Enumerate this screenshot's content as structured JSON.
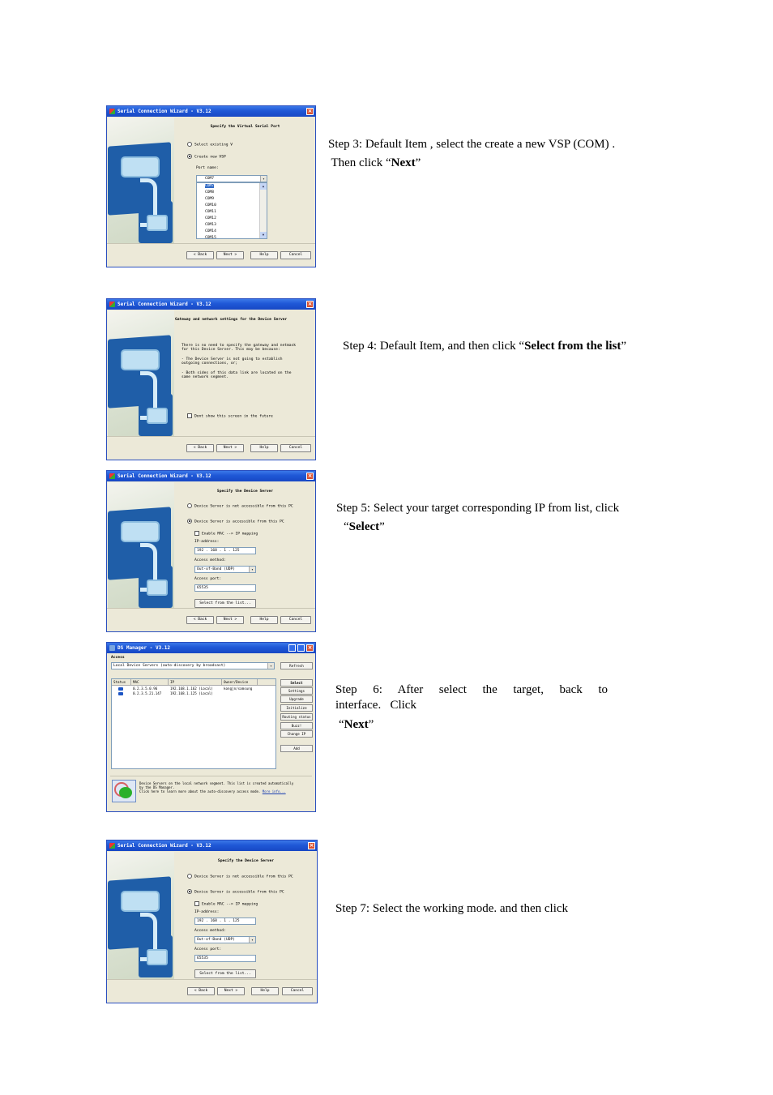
{
  "steps": [
    {
      "id": "step3",
      "text_line1": "Step 3: Default Item , select the create a new VSP (COM) .",
      "text_line2_prefix": " Then click “",
      "text_bold": "Next",
      "text_suffix": "”"
    },
    {
      "id": "step4",
      "text_prefix": "Step 4: Default Item, and then click “",
      "text_bold": "Select from the list",
      "text_suffix": "”"
    },
    {
      "id": "step5",
      "text_line1": "Step 5: Select your target corresponding IP from list, click",
      "text_line2_prefix": "“",
      "text_bold": "Select",
      "text_suffix": "”"
    },
    {
      "id": "step6",
      "text_line1": "Step 6: After select the target, back to",
      "text_line2": "interface.   Click",
      "text_line3_prefix": "“",
      "text_bold": "Next",
      "text_suffix": "”"
    },
    {
      "id": "step7",
      "text": "Step 7: Select the working mode. and then click"
    }
  ],
  "wizard": {
    "title": "Serial Connection Wizard - V3.12",
    "buttons": {
      "back": "< Back",
      "next": "Next >",
      "help": "Help",
      "cancel": "Cancel"
    }
  },
  "screen_vsp": {
    "heading": "Specify the Virtual Serial Port",
    "radio_existing": "Select existing V",
    "radio_create": "Create new VSP",
    "port_label": "Port name:",
    "port_value": "COM7",
    "port_options": [
      "COM7",
      "COM8",
      "COM9",
      "COM10",
      "COM11",
      "COM12",
      "COM13",
      "COM14",
      "COM15"
    ],
    "selected_option": "COM7"
  },
  "screen_gateway": {
    "heading": "Gateway and network settings for the Device Server",
    "para1": "There is no need to specify the gateway and netmask",
    "para1b": "for this Device Server. This may be because:",
    "para2": "- The Device Server is not going to establish",
    "para2b": "outgoing connections, or;",
    "para3": "- Both sides of this data link are located on the",
    "para3b": "same network segment.",
    "checkbox": "Dont show this screen in the future"
  },
  "screen_device": {
    "heading": "Specify the Device Server",
    "radio_not_accessible": "Device Server is not accessible from this PC",
    "radio_accessible": "Device Server is accessible from this PC",
    "mac_mapping": "Enable MAC --> IP mapping",
    "ip_label": "IP-address:",
    "ip_value": "192 . 168 .  1  . 125",
    "access_method_label": "Access method:",
    "access_method_value": "Out-of-Band (UDP)",
    "access_port_label": "Access port:",
    "access_port_value": "65535",
    "select_list_button": "Select from the list..."
  },
  "ds_manager": {
    "title": "DS Manager - V3.12",
    "access_label": "Access",
    "access_value": "Local Device Servers (auto-discovery by broadcast)",
    "refresh_button": "Refresh",
    "columns": [
      "Status",
      "MAC",
      "IP",
      "Owner/Device"
    ],
    "rows": [
      {
        "mac": "0.2.3.5.0.96",
        "ip": "192.168.1.162 (Local)",
        "owner": "kongjn/samsung"
      },
      {
        "mac": "0.2.3.5.21.147",
        "ip": "192.168.1.125 (Local)",
        "owner": ""
      }
    ],
    "side_buttons": [
      "Select",
      "Settings",
      "Upgrade",
      "Initialize",
      "Routing status",
      "Buzz!",
      "Change IP",
      "Add"
    ],
    "info_line1": "Device Servers on the local network segment. This list is created automatically",
    "info_line2": "by the DS Manager.",
    "info_line3": "Click here to learn more about the auto-discovery access mode.",
    "info_link": "More info..."
  }
}
